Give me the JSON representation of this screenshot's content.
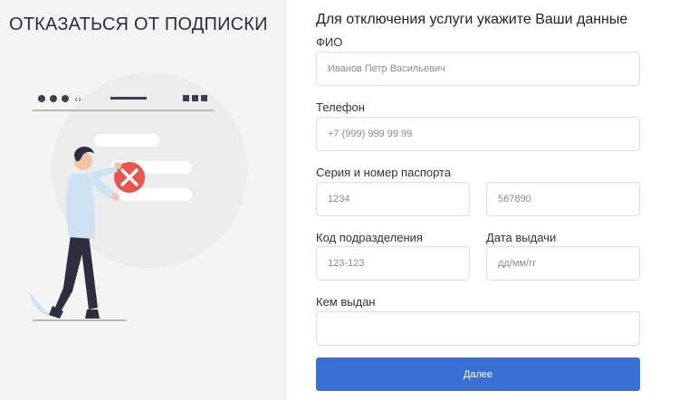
{
  "page": {
    "title": "ОТКАЗАТЬСЯ ОТ ПОДПИСКИ"
  },
  "illustration": {
    "description_icon": "person-with-browser-window-error-icon",
    "browser_nav_glyph": "‹›",
    "colors": {
      "circle": "#ececec",
      "error_badge": "#e8554e",
      "shirt": "#cfe2f3",
      "pants": "#2f2e41",
      "ink": "#3f3d56"
    }
  },
  "form": {
    "heading": "Для отключения услуги укажите Ваши данные",
    "fio": {
      "label": "ФИО",
      "placeholder": "Иванов Петр Васильевич"
    },
    "phone": {
      "label": "Телефон",
      "placeholder": "+7 (999) 999 99 99"
    },
    "passport": {
      "label": "Серия и номер паспорта",
      "series_placeholder": "1234",
      "number_placeholder": "567890"
    },
    "division_code": {
      "label": "Код подразделения",
      "placeholder": "123-123"
    },
    "issue_date": {
      "label": "Дата выдачи",
      "placeholder": "дд/мм/гг"
    },
    "issued_by": {
      "label": "Кем выдан",
      "placeholder": ""
    },
    "submit_label": "Далее"
  },
  "colors": {
    "accent": "#3a6fd6",
    "page_background": "#f4f4f5",
    "panel_background": "#ffffff"
  }
}
